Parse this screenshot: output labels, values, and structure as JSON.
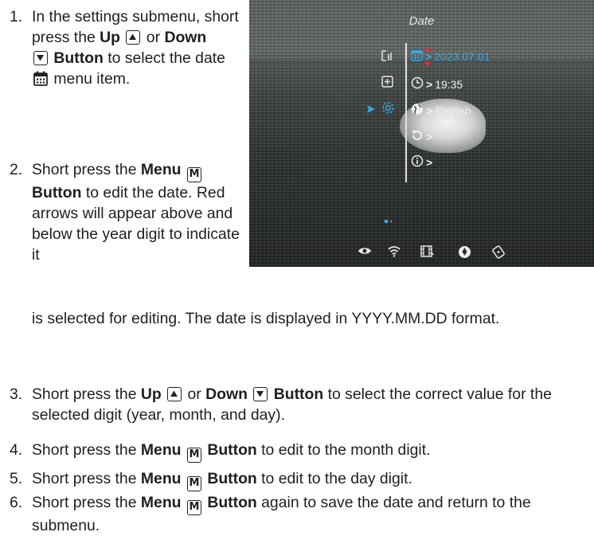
{
  "steps": [
    {
      "number": "1.",
      "t1": "In the settings submenu, short press the ",
      "up": "Up",
      "t2": " or ",
      "down": "Down",
      "t3": " ",
      "button": "Button",
      "t4": " to select the date ",
      "t5": " menu item."
    },
    {
      "number": "2.",
      "t1": "Short press the ",
      "menu": "Menu",
      "t2": " ",
      "button": "Button",
      "t3": " to edit the date. Red arrows will appear above and below the year digit to indicate it",
      "t4": "is selected for editing. The date is displayed in YYYY.MM.DD format."
    },
    {
      "number": "3.",
      "t1": "Short press the ",
      "up": "Up",
      "t2": " or ",
      "down": "Down",
      "t3": " ",
      "button": "Button",
      "t4": " to select the correct value for the selected digit (year, month, and day)."
    },
    {
      "number": "4.",
      "t1": "Short press the ",
      "menu": "Menu",
      "t2": " ",
      "button": "Button",
      "t3": " to edit to the month digit."
    },
    {
      "number": "5.",
      "t1": "Short press the ",
      "menu": "Menu",
      "t2": " ",
      "button": "Button",
      "t3": " to edit to the day digit."
    },
    {
      "number": "6.",
      "t1": "Short press the ",
      "menu": "Menu",
      "t2": " ",
      "button": "Button",
      "t3": " again to save the date and return to the submenu."
    }
  ],
  "key_icons": {
    "up": "up-arrow-key-icon",
    "down": "down-arrow-key-icon",
    "menu": "menu-m-key-icon",
    "menu_glyph": "M"
  },
  "screen": {
    "title": "Date",
    "rows": [
      {
        "icon": "calendar-icon",
        "value": "2023.07.01",
        "selected": true
      },
      {
        "icon": "clock-icon",
        "value": "19:35"
      },
      {
        "icon": "globe-icon",
        "value": "English"
      },
      {
        "icon": "reset-icon",
        "value": ""
      },
      {
        "icon": "info-icon",
        "value": ""
      }
    ],
    "arrow_glyph": ">",
    "accent_color": "#35a9e8",
    "edit_arrow_color": "#e8303a",
    "bottom_icons": [
      "eye-icon",
      "wifi-icon",
      "film-icon",
      "aperture-icon",
      "battery-icon"
    ]
  }
}
